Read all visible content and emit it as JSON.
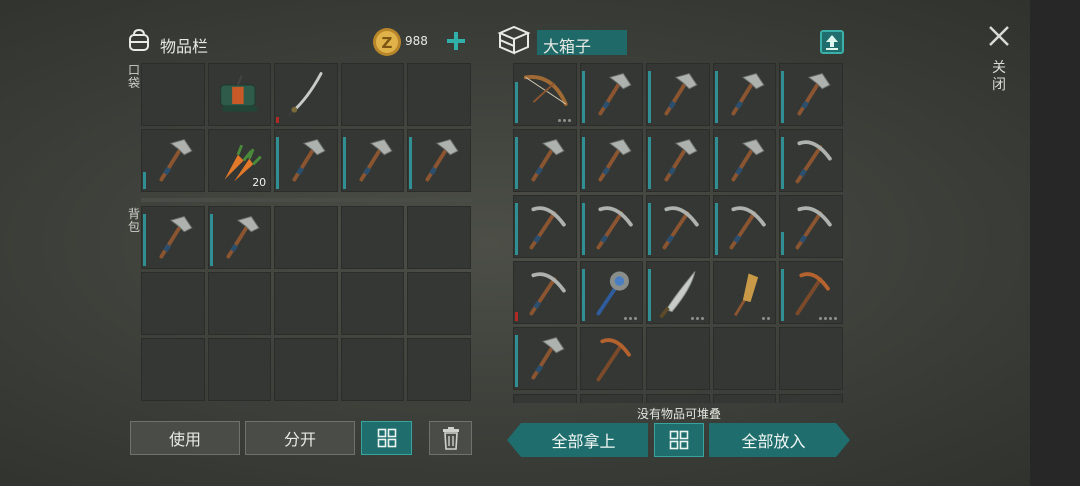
{
  "inventory": {
    "title": "物品栏",
    "icon": "backpack-icon",
    "coins": "988",
    "add_icon": "plus-icon"
  },
  "chest": {
    "title": "大箱子",
    "icon": "chest-box-icon",
    "upload_icon": "upload-icon"
  },
  "close": {
    "label": "关闭",
    "icon": "close-icon"
  },
  "pockets": {
    "label": "口袋",
    "slots": [
      {
        "item": "empty"
      },
      {
        "item": "dynamite"
      },
      {
        "item": "katana",
        "durability": 0.1,
        "dur_color": "red"
      },
      {
        "item": "empty"
      },
      {
        "item": "empty"
      },
      {
        "item": "hammer",
        "durability": 0.3
      },
      {
        "item": "carrot",
        "count": "20"
      },
      {
        "item": "hammer",
        "durability": 0.9
      },
      {
        "item": "hammer",
        "durability": 0.9
      },
      {
        "item": "hammer",
        "durability": 0.9
      }
    ]
  },
  "backpack": {
    "label": "背包",
    "slots": [
      {
        "item": "hammer",
        "durability": 0.9
      },
      {
        "item": "hammer",
        "durability": 0.9
      },
      {
        "item": "empty"
      },
      {
        "item": "empty"
      },
      {
        "item": "empty"
      },
      {
        "item": "empty"
      },
      {
        "item": "empty"
      },
      {
        "item": "empty"
      },
      {
        "item": "empty"
      },
      {
        "item": "empty"
      },
      {
        "item": "empty"
      },
      {
        "item": "empty"
      },
      {
        "item": "empty"
      },
      {
        "item": "empty"
      },
      {
        "item": "empty"
      }
    ]
  },
  "chest_slots": [
    {
      "item": "bow",
      "durability": 0.7,
      "dots": 3
    },
    {
      "item": "hammer",
      "durability": 0.9
    },
    {
      "item": "hammer",
      "durability": 0.9
    },
    {
      "item": "hammer",
      "durability": 0.9
    },
    {
      "item": "hammer",
      "durability": 0.9
    },
    {
      "item": "hammer",
      "durability": 0.9
    },
    {
      "item": "hammer",
      "durability": 0.9
    },
    {
      "item": "hammer",
      "durability": 0.9
    },
    {
      "item": "hammer",
      "durability": 0.9
    },
    {
      "item": "pickaxe",
      "durability": 0.9
    },
    {
      "item": "pickaxe",
      "durability": 0.9
    },
    {
      "item": "pickaxe",
      "durability": 0.9
    },
    {
      "item": "pickaxe",
      "durability": 0.9
    },
    {
      "item": "pickaxe",
      "durability": 0.9
    },
    {
      "item": "pickaxe",
      "durability": 0.4
    },
    {
      "item": "pickaxe",
      "durability": 0.15,
      "dur_color": "red"
    },
    {
      "item": "mace",
      "durability": 0.9,
      "dots": 3
    },
    {
      "item": "machete",
      "durability": 0.9,
      "dots": 3
    },
    {
      "item": "broom",
      "durability": 0,
      "dots": 2
    },
    {
      "item": "copper-pickaxe",
      "durability": 0.9,
      "dots": 4
    },
    {
      "item": "hammer",
      "durability": 0.9
    },
    {
      "item": "copper-pickaxe",
      "durability": 0
    },
    {
      "item": "empty"
    },
    {
      "item": "empty"
    },
    {
      "item": "empty"
    }
  ],
  "status": "没有物品可堆叠",
  "buttons": {
    "use": "使用",
    "split": "分开",
    "take_all": "全部拿上",
    "put_all": "全部放入",
    "sort_icon": "sort-grid-icon",
    "trash_icon": "trash-icon"
  }
}
